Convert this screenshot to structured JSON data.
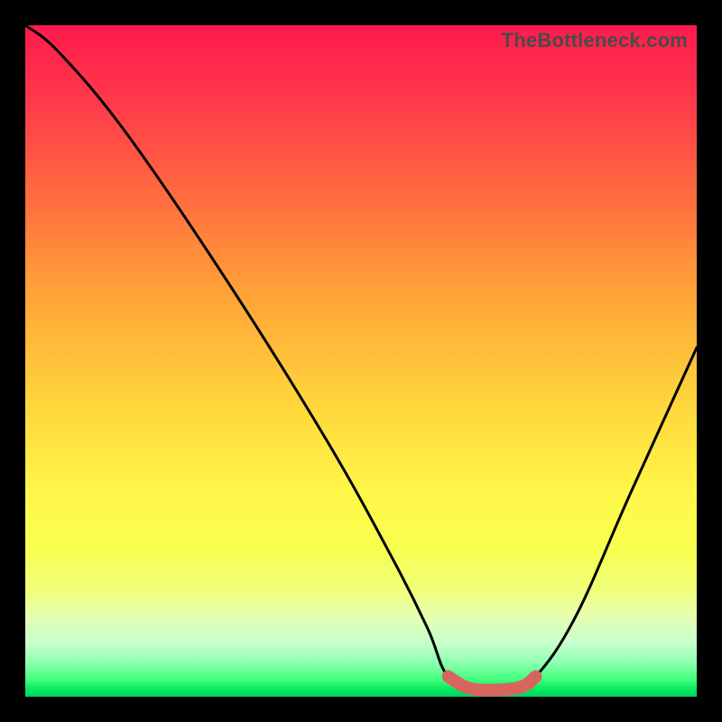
{
  "watermark": "TheBottleneck.com",
  "chart_data": {
    "type": "line",
    "title": "",
    "xlabel": "",
    "ylabel": "",
    "xlim": [
      0,
      100
    ],
    "ylim": [
      0,
      100
    ],
    "grid": false,
    "legend": false,
    "series": [
      {
        "name": "bottleneck-curve",
        "x": [
          0,
          5,
          15,
          30,
          45,
          55,
          60,
          63,
          68,
          72,
          76,
          82,
          90,
          100
        ],
        "values": [
          100,
          96,
          84,
          62,
          38,
          20,
          10,
          3,
          1,
          1,
          3,
          12,
          30,
          52
        ]
      }
    ],
    "highlight": {
      "name": "optimal-range",
      "x": [
        63,
        66,
        70,
        74,
        76
      ],
      "values": [
        3,
        1.3,
        1,
        1.5,
        3
      ]
    },
    "gradient_stops": [
      {
        "pct": 0,
        "color": "#ff1a4d"
      },
      {
        "pct": 25,
        "color": "#ff6a3f"
      },
      {
        "pct": 55,
        "color": "#ffd23a"
      },
      {
        "pct": 78,
        "color": "#f7ff4f"
      },
      {
        "pct": 95,
        "color": "#8cffb0"
      },
      {
        "pct": 100,
        "color": "#00d060"
      }
    ]
  }
}
